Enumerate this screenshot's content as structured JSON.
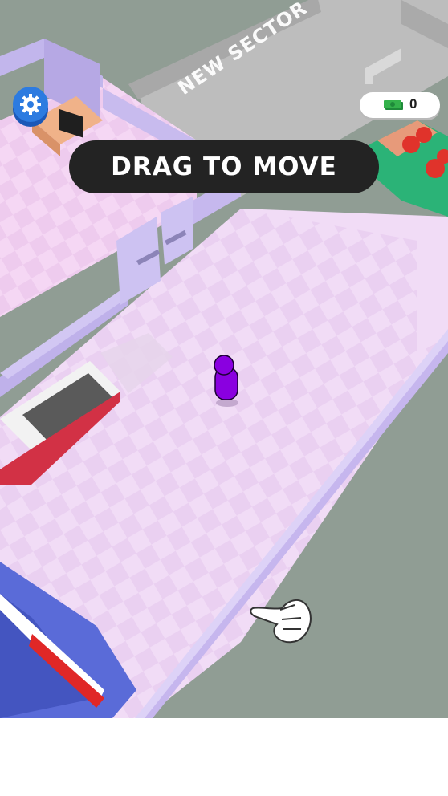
{
  "hud": {
    "money_value": "0",
    "icons": {
      "settings": "gear-icon",
      "money": "cash-stack-icon",
      "tutorial_hand": "pointing-hand-icon"
    }
  },
  "tutorial": {
    "hint_text": "DRAG TO MOVE"
  },
  "world": {
    "sector_label": "NEW SECTOR"
  },
  "colors": {
    "floor": "#f2ddf7",
    "wall": "#c5b4ec",
    "player": "#8a00e0",
    "hint_bg": "#232323",
    "settings_blue": "#2d7be0"
  }
}
